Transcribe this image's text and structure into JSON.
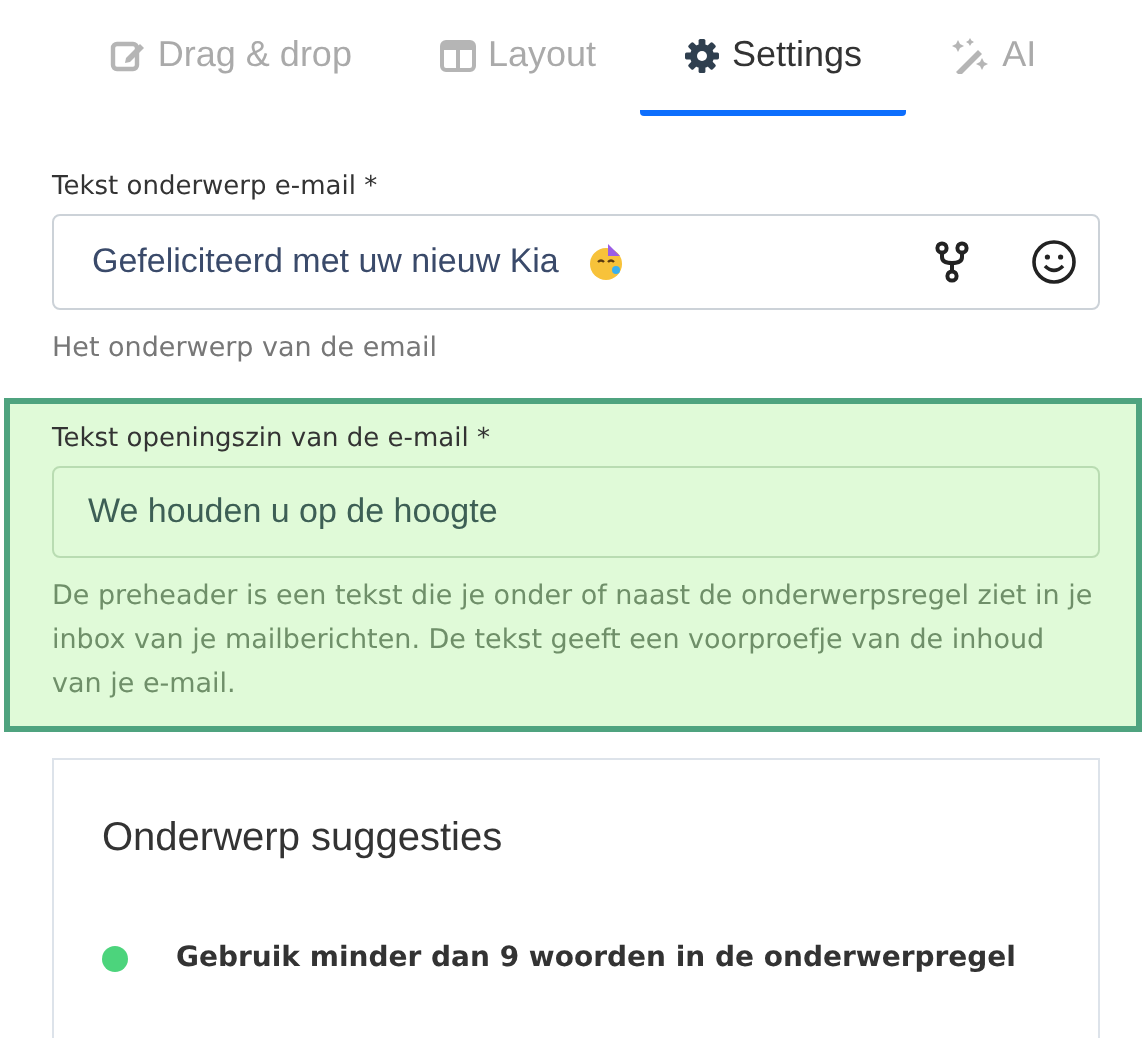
{
  "tabs": [
    {
      "label": "Drag & drop",
      "selected": false
    },
    {
      "label": "Layout",
      "selected": false
    },
    {
      "label": "Settings",
      "selected": true
    },
    {
      "label": "AI",
      "selected": false
    }
  ],
  "subject": {
    "label": "Tekst onderwerp e-mail *",
    "value": "Gefeliciteerd met uw nieuw Kia",
    "hint": "Het onderwerp van de email"
  },
  "preheader": {
    "label": "Tekst openingszin van de e-mail *",
    "value": "We houden u op de hoogte",
    "hint": "De preheader is een tekst die je onder of naast de onderwerpsregel ziet in je inbox van je mailberichten. De tekst geeft een voorproefje van de inhoud van je e-mail.",
    "highlighted": true
  },
  "suggestions": {
    "title": "Onderwerp suggesties",
    "items": [
      {
        "text": "Gebruik minder dan 9 woorden in de onderwerpregel",
        "color": "#4cd47c"
      }
    ]
  }
}
